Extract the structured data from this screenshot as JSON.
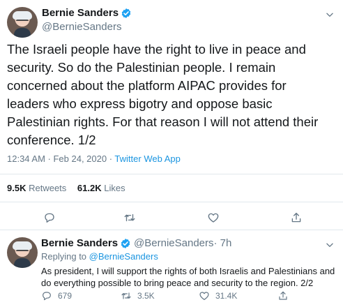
{
  "main_tweet": {
    "author_name": "Bernie Sanders",
    "author_handle": "@BernieSanders",
    "text": "The Israeli people have the right to live in peace and\nsecurity. So do the Palestinian people. I remain\nconcerned about the platform AIPAC provides for\nleaders who express bigotry and oppose basic\nPalestinian rights. For that reason I will not attend their\nconference. 1/2",
    "timestamp": "12:34 AM · Feb 24, 2020 · ",
    "client": "Twitter Web App",
    "retweets_count": "9.5K",
    "retweets_label": "Retweets",
    "likes_count": "61.2K",
    "likes_label": "Likes"
  },
  "reply_tweet": {
    "author_name": "Bernie Sanders",
    "author_handle": "@BernieSanders",
    "age": " · 7h",
    "replying_prefix": "Replying to ",
    "replying_to": "@BernieSanders",
    "text": "As president, I will support the rights of both Israelis and Palestinians and do everything possible to bring peace and security to the region. 2/2",
    "reply_count": "679",
    "retweet_count": "3.5K",
    "like_count": "31.4K"
  },
  "colors": {
    "accent": "#1da1f2",
    "link": "#1b95e0",
    "muted": "#657786",
    "divider": "#e1e8ed"
  },
  "icons": [
    "verified-badge-icon",
    "chevron-down-icon",
    "reply-icon",
    "retweet-icon",
    "like-icon",
    "share-icon"
  ]
}
